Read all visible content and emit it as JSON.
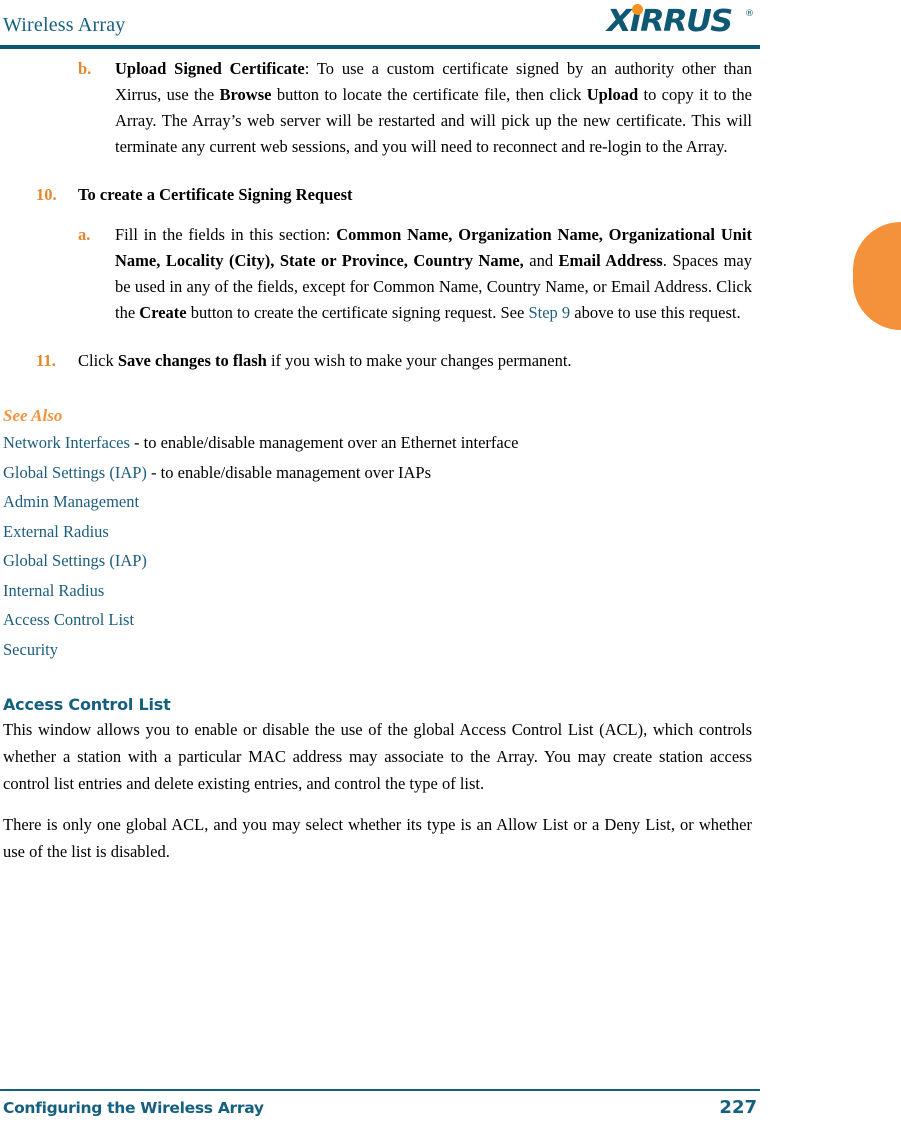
{
  "header": {
    "title": "Wireless Array",
    "logo_text": "XIRRUS",
    "logo_registered": "®",
    "logo_color": "#0F5874",
    "logo_dot_color": "#F6921E"
  },
  "side_tab": {
    "color": "#F4923C"
  },
  "colors": {
    "teal": "#15607E",
    "link": "#1D5D7D",
    "orange": "#F4923C",
    "marker_orange": "#E8852A"
  },
  "steps": [
    {
      "marker": "b.",
      "marker_type": "lettered",
      "text_parts": [
        {
          "text": "Upload Signed Certificate",
          "style": "bold"
        },
        {
          "text": ": To use a custom certificate signed by an authority other than Xirrus, use the ",
          "style": "plain"
        },
        {
          "text": "Browse",
          "style": "bold"
        },
        {
          "text": " button to locate the certificate file, then click ",
          "style": "plain"
        },
        {
          "text": "Upload",
          "style": "bold"
        },
        {
          "text": " to copy it to the Array. The Array’s web server will be restarted and will pick up the new certificate. This will terminate any current web sessions, and you will need to reconnect and re-login to the Array.",
          "style": "plain"
        }
      ]
    },
    {
      "marker": "10.",
      "marker_type": "numbered",
      "text_parts": [
        {
          "text": "To create a Certificate Signing Request",
          "style": "bold"
        }
      ],
      "no_justify": true
    },
    {
      "marker": "a.",
      "marker_type": "lettered",
      "text_parts": [
        {
          "text": "Fill in the fields in this section: ",
          "style": "plain"
        },
        {
          "text": "Common Name, Organization Name, Organizational Unit Name, Locality (City), State or Province, Country Name,",
          "style": "bold"
        },
        {
          "text": " and ",
          "style": "plain"
        },
        {
          "text": "Email Address",
          "style": "bold"
        },
        {
          "text": ". Spaces may be used in any of the fields, except for Common Name, Country Name, or Email Address. Click the ",
          "style": "plain"
        },
        {
          "text": "Create",
          "style": "bold"
        },
        {
          "text": " button to create the certificate signing request. See ",
          "style": "plain"
        },
        {
          "text": "Step 9",
          "style": "link"
        },
        {
          "text": " above to use this request.",
          "style": "plain"
        }
      ]
    },
    {
      "marker": "11.",
      "marker_type": "numbered",
      "text_parts": [
        {
          "text": "Click ",
          "style": "plain"
        },
        {
          "text": "Save changes to flash",
          "style": "bold"
        },
        {
          "text": " if you wish to make your changes permanent.",
          "style": "plain"
        }
      ]
    }
  ],
  "see_also": {
    "heading": "See Also",
    "items": [
      {
        "link": "Network Interfaces",
        "desc": " - to enable/disable management over an Ethernet interface"
      },
      {
        "link": "Global Settings (IAP)",
        "desc": " - to enable/disable management over IAPs"
      },
      {
        "link": "Admin Management",
        "desc": ""
      },
      {
        "link": "External Radius",
        "desc": ""
      },
      {
        "link": "Global Settings (IAP)",
        "desc": ""
      },
      {
        "link": "Internal Radius",
        "desc": ""
      },
      {
        "link": "Access Control List",
        "desc": ""
      },
      {
        "link": "Security",
        "desc": ""
      }
    ]
  },
  "section": {
    "heading": "Access Control List",
    "paragraphs": [
      "This window allows you to enable or disable the use of the global Access Control List (ACL), which controls whether a station with a particular MAC address may associate to the Array. You may create station access control list entries and delete existing entries, and control the type of list.",
      "There is only one global ACL, and you may select whether its type is an Allow List or a Deny List, or whether use of the list is disabled."
    ]
  },
  "footer": {
    "left": "Configuring the Wireless Array",
    "page_number": "227"
  }
}
